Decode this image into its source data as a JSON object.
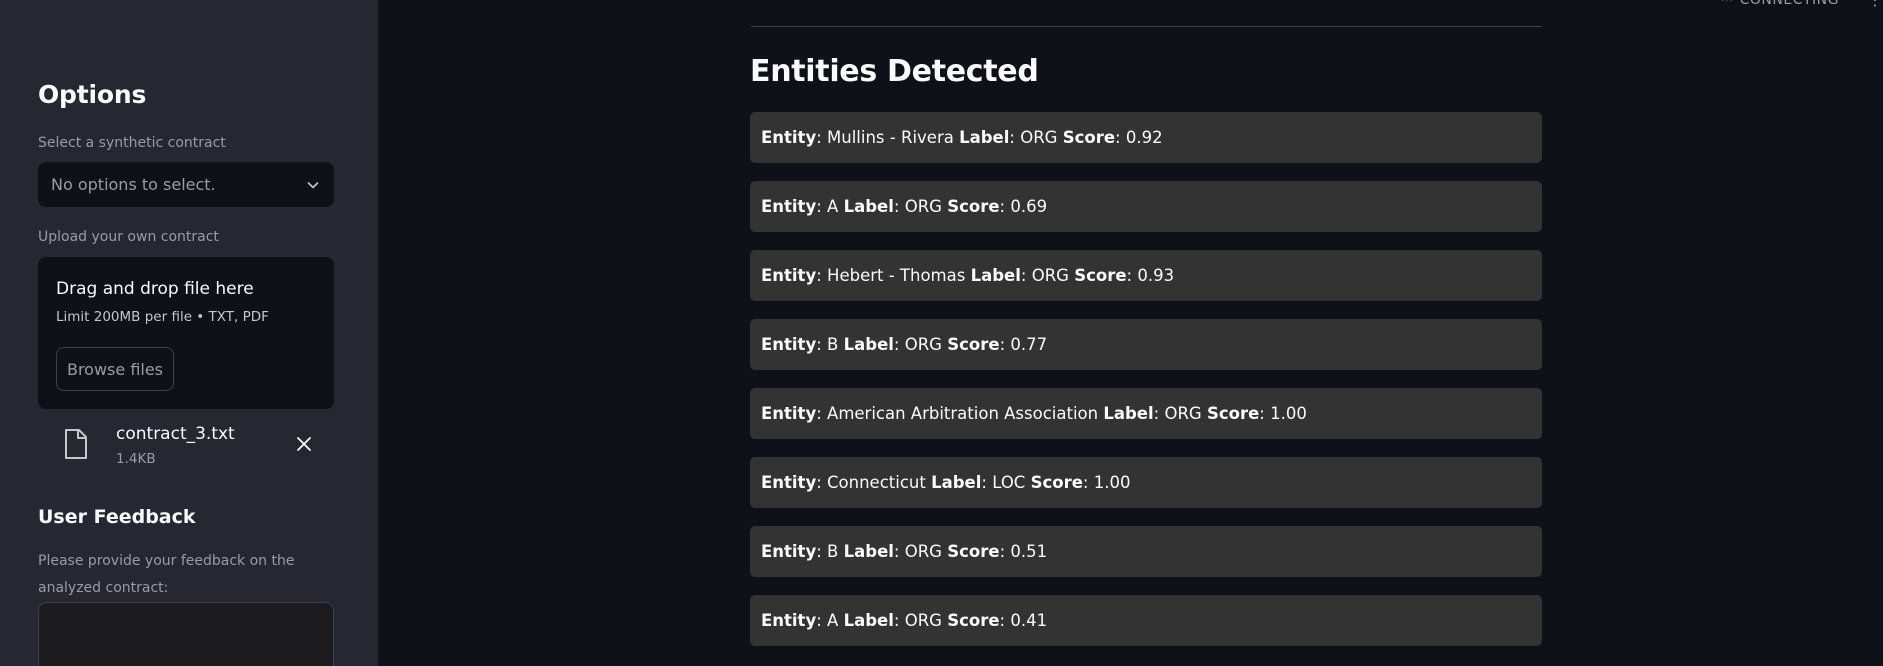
{
  "sidebar": {
    "title": "Options",
    "select_label": "Select a synthetic contract",
    "select_value": "No options to select.",
    "upload_label": "Upload your own contract",
    "dropzone_title": "Drag and drop file here",
    "dropzone_limit": "Limit 200MB per file • TXT, PDF",
    "browse_label": "Browse files",
    "file": {
      "name": "contract_3.txt",
      "size": "1.4KB"
    },
    "feedback_title": "User Feedback",
    "feedback_help": "Please provide your feedback on the analyzed contract:"
  },
  "main": {
    "title": "Entities Detected",
    "status": "CONNECTING",
    "field_labels": {
      "entity": "Entity",
      "label": "Label",
      "score": "Score"
    },
    "entities": [
      {
        "entity": "Mullins - Rivera",
        "label": "ORG",
        "score": "0.92"
      },
      {
        "entity": "A",
        "label": "ORG",
        "score": "0.69"
      },
      {
        "entity": "Hebert - Thomas",
        "label": "ORG",
        "score": "0.93"
      },
      {
        "entity": "B",
        "label": "ORG",
        "score": "0.77"
      },
      {
        "entity": "American Arbitration Association",
        "label": "ORG",
        "score": "1.00"
      },
      {
        "entity": "Connecticut",
        "label": "LOC",
        "score": "1.00"
      },
      {
        "entity": "B",
        "label": "ORG",
        "score": "0.51"
      },
      {
        "entity": "A",
        "label": "ORG",
        "score": "0.41"
      }
    ]
  },
  "colors": {
    "background": "#0e1117",
    "sidebar": "#262730",
    "entity_box": "#333333",
    "muted_text": "#9a9ca3"
  },
  "icons": [
    "chevron-down-icon",
    "file-icon",
    "close-icon",
    "status-dots-icon",
    "menu-dots-icon"
  ]
}
